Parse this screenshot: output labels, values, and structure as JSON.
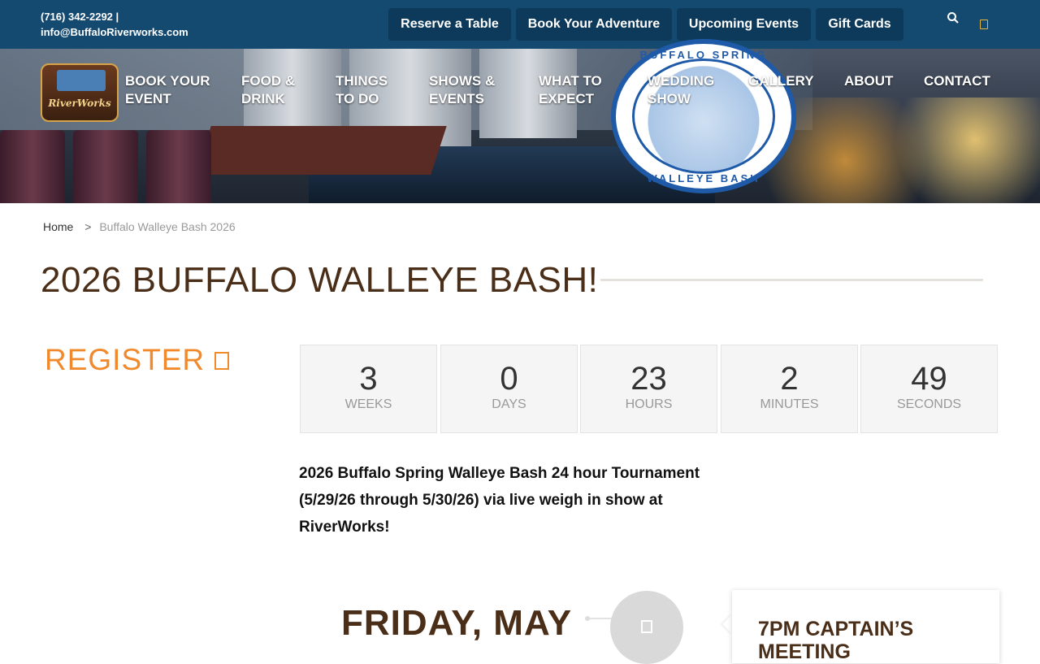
{
  "topbar": {
    "phone": "(716) 342-2292 |",
    "email": "info@BuffaloRiverworks.com",
    "buttons": [
      "Reserve a Table",
      "Book Your Adventure",
      "Upcoming Events",
      "Gift Cards"
    ],
    "icons": [
      "search-icon",
      "cart-icon"
    ],
    "accent": "#154a70",
    "button_bg": "#0d3a5a"
  },
  "logo": {
    "text": "RiverWorks"
  },
  "badge": {
    "top_text": "BUFFALO SPRING",
    "bottom_text": "WALLEYE BASH"
  },
  "nav": [
    {
      "line1": "BOOK YOUR",
      "line2": "EVENT"
    },
    {
      "line1": "FOOD &",
      "line2": "DRINK"
    },
    {
      "line1": "THINGS",
      "line2": "TO DO"
    },
    {
      "line1": "SHOWS &",
      "line2": "EVENTS"
    },
    {
      "line1": "WHAT TO",
      "line2": "EXPECT"
    },
    {
      "line1": "WEDDING",
      "line2": "SHOW"
    },
    {
      "line1": "GALLERY",
      "line2": ""
    },
    {
      "line1": "ABOUT",
      "line2": ""
    },
    {
      "line1": "CONTACT",
      "line2": ""
    }
  ],
  "breadcrumb": {
    "home": "Home",
    "separator": ">",
    "current": "Buffalo Walleye Bash 2026"
  },
  "page": {
    "title": "2026 BUFFALO WALLEYE BASH!",
    "register": "REGISTER",
    "description": "2026 Buffalo Spring Walleye Bash 24 hour Tournament (5/29/26 through 5/30/26) via live weigh in show at RiverWorks!",
    "title_color": "#4a2e18",
    "register_color": "#f08a2c"
  },
  "countdown": [
    {
      "value": "3",
      "label": "WEEKS"
    },
    {
      "value": "0",
      "label": "DAYS"
    },
    {
      "value": "23",
      "label": "HOURS"
    },
    {
      "value": "2",
      "label": "MINUTES"
    },
    {
      "value": "49",
      "label": "SECONDS"
    }
  ],
  "schedule": {
    "day_heading": "FRIDAY, MAY",
    "event_title": "7PM CAPTAIN’S MEETING"
  }
}
